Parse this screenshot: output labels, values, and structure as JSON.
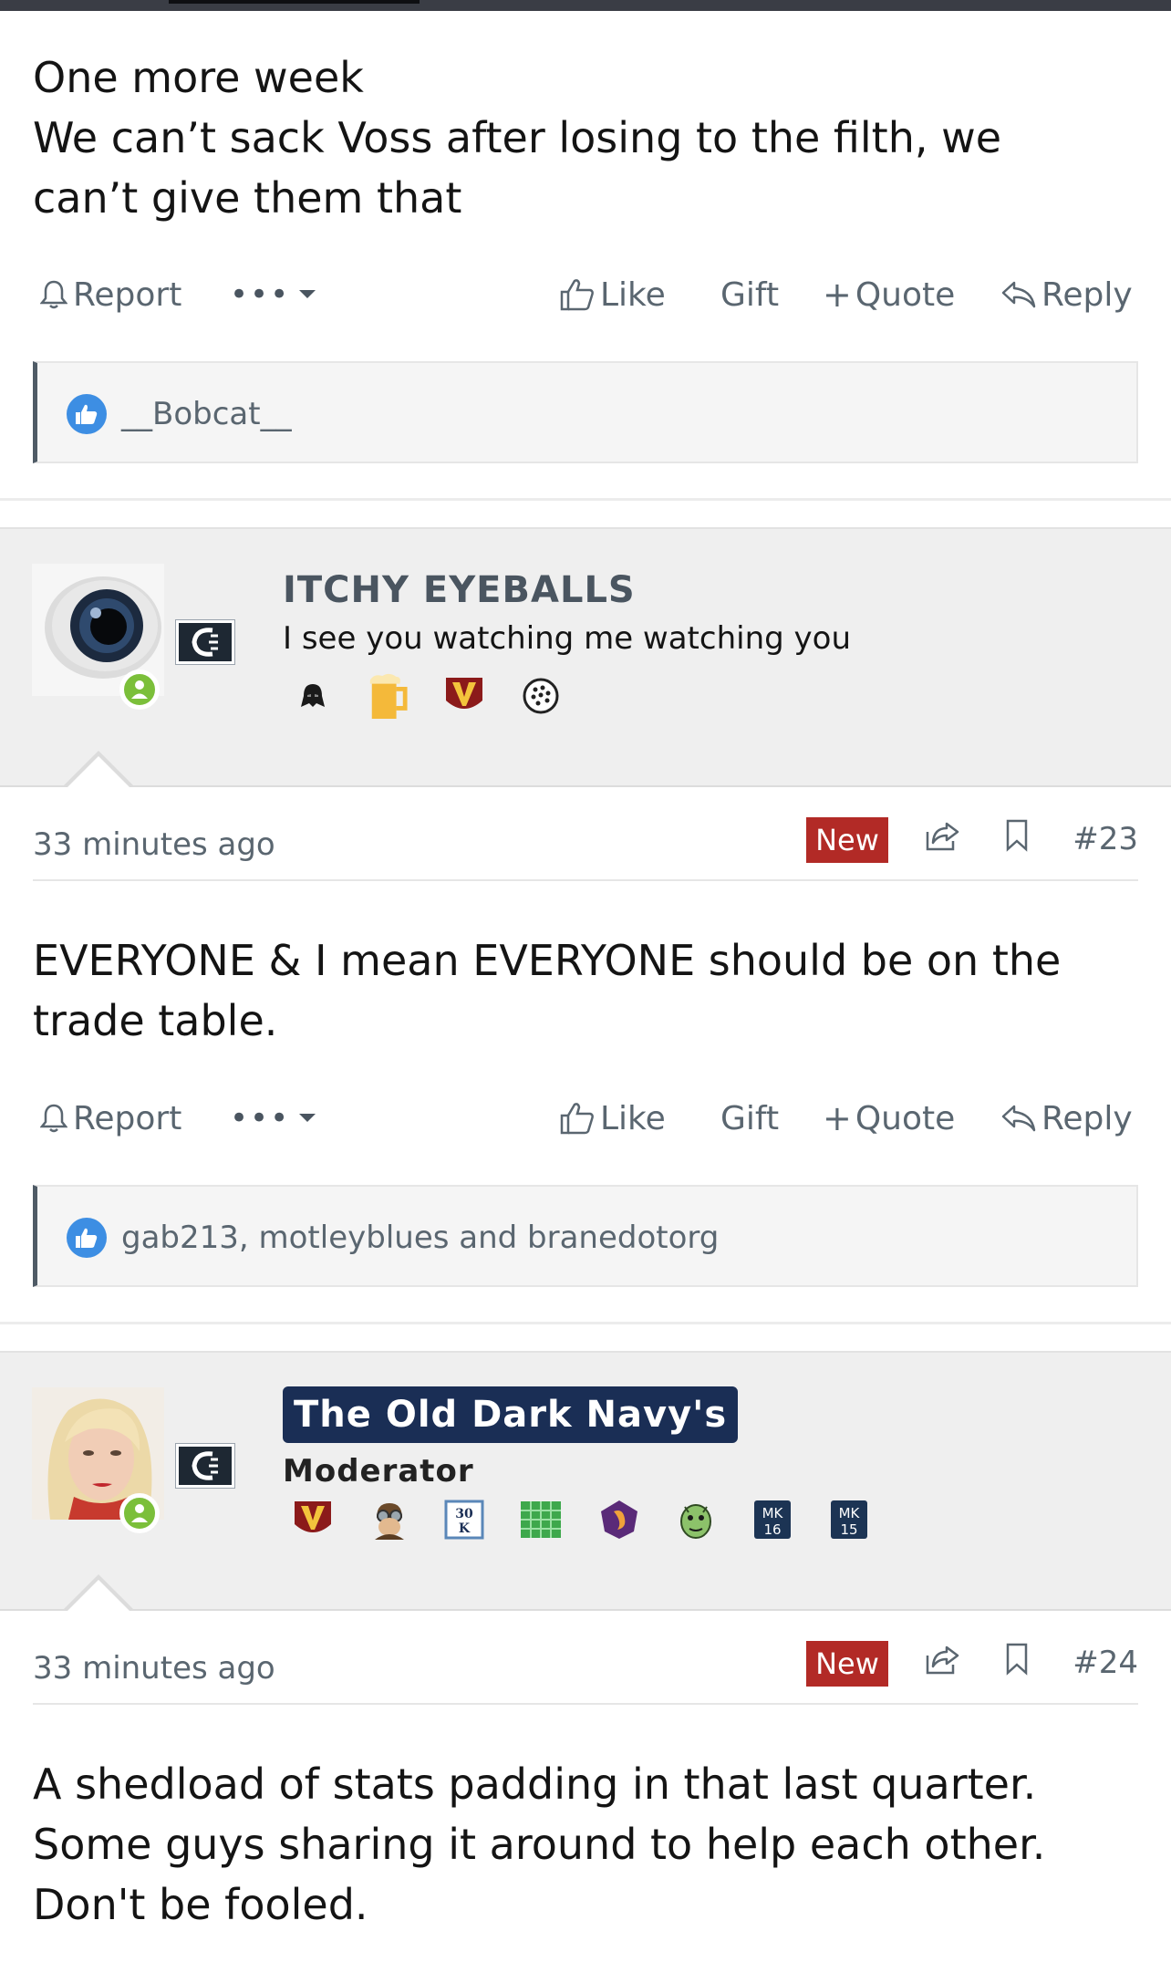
{
  "post1": {
    "body_lines": [
      "One more week",
      "We can’t sack Voss after losing to the filth, we",
      "can’t give them that"
    ],
    "actions": {
      "report": "Report",
      "more": "•••",
      "like": "Like",
      "gift": "Gift",
      "quote": "Quote",
      "reply": "Reply"
    },
    "reactions": "__Bobcat__"
  },
  "post2": {
    "user": {
      "name": "ITCHY EYEBALLS",
      "title": "I see you watching me watching you",
      "badges": [
        "darth-vader-badge",
        "beer-mug-badge",
        "v-shield-badge",
        "golf-ball-badge"
      ]
    },
    "time": "33 minutes ago",
    "new_label": "New",
    "number": "#23",
    "body_lines": [
      "EVERYONE & I mean EVERYONE should be on the",
      "trade table."
    ],
    "actions": {
      "report": "Report",
      "more": "•••",
      "like": "Like",
      "gift": "Gift",
      "quote": "Quote",
      "reply": "Reply"
    },
    "reactions": "gab213, motleyblues and branedotorg"
  },
  "post3": {
    "user": {
      "name": "The Old Dark Navy's",
      "title": "Moderator",
      "badges": [
        "v-shield-badge",
        "aviator-badge",
        "30k-badge",
        "green-grid-badge",
        "purple-shield-badge",
        "green-face-badge",
        "mk16-badge",
        "mk15-badge"
      ],
      "badge_texts": {
        "k30_top": "30",
        "k30_bottom": "K",
        "mk16_top": "MK",
        "mk16_bottom": "16",
        "mk15_top": "MK",
        "mk15_bottom": "15"
      }
    },
    "time": "33 minutes ago",
    "new_label": "New",
    "number": "#24",
    "body_lines": [
      "A shedload of stats padding in that last quarter.",
      "Some guys sharing it around to help each other.",
      "Don't be fooled."
    ]
  },
  "colors": {
    "accent_new": "#b22a26",
    "link": "#5a6670",
    "like_blue": "#3d8ee3",
    "moderator_bg": "#1a2e55",
    "online": "#7bbf3a"
  }
}
